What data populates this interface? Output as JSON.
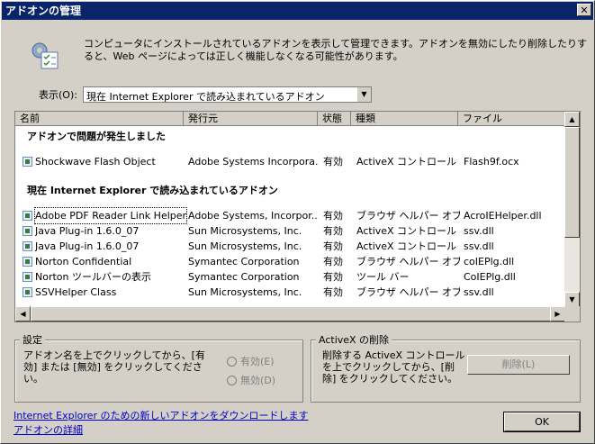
{
  "window": {
    "title": "アドオンの管理",
    "close_glyph": "✕"
  },
  "intro": "コンピュータにインストールされているアドオンを表示して管理できます。アドオンを無効にしたり削除したりすると、Web ページによっては正しく機能しなくなる可能性があります。",
  "show": {
    "label": "表示(O):",
    "selected": "現在 Internet Explorer で読み込まれているアドオン",
    "arrow": "▼"
  },
  "list": {
    "columns": [
      "名前",
      "発行元",
      "状態",
      "種類",
      "ファイル"
    ],
    "groups": [
      {
        "title": "アドオンで問題が発生しました",
        "rows": [
          [
            "Shockwave Flash Object",
            "Adobe Systems Incorpora...",
            "有効",
            "ActiveX コントロール",
            "Flash9f.ocx"
          ]
        ]
      },
      {
        "title": "現在 Internet Explorer で読み込まれているアドオン",
        "rows": [
          [
            "Adobe PDF Reader Link Helper",
            "Adobe Systems, Incorpor...",
            "有効",
            "ブラウザ ヘルパー オブ...",
            "AcroIEHelper.dll"
          ],
          [
            "Java Plug-in 1.6.0_07",
            "Sun Microsystems, Inc.",
            "有効",
            "ActiveX コントロール",
            "ssv.dll"
          ],
          [
            "Java Plug-in 1.6.0_07",
            "Sun Microsystems, Inc.",
            "有効",
            "ActiveX コントロール",
            "ssv.dll"
          ],
          [
            "Norton Confidential",
            "Symantec Corporation",
            "有効",
            "ブラウザ ヘルパー オブ...",
            "coIEPlg.dll"
          ],
          [
            "Norton ツールバーの表示",
            "Symantec Corporation",
            "有効",
            "ツール バー",
            "CoIEPlg.dll"
          ],
          [
            "SSVHelper Class",
            "Sun Microsystems, Inc.",
            "有効",
            "ブラウザ ヘルパー オブ...",
            "ssv.dll"
          ]
        ]
      }
    ],
    "arrows": {
      "up": "▲",
      "down": "▼",
      "left": "◀",
      "right": "▶"
    }
  },
  "settings": {
    "legend": "設定",
    "text": "アドオン名を上でクリックしてから、[有効] または [無効] をクリックしてください。",
    "enable": "有効(E)",
    "disable": "無効(D)"
  },
  "activex": {
    "legend": "ActiveX の削除",
    "text": "削除する ActiveX コントロールを上でクリックしてから、[削除] をクリックしてください。",
    "delete": "削除(L)"
  },
  "links": {
    "download": "Internet Explorer のための新しいアドオンをダウンロードします",
    "details": "アドオンの詳細"
  },
  "ok": "OK"
}
